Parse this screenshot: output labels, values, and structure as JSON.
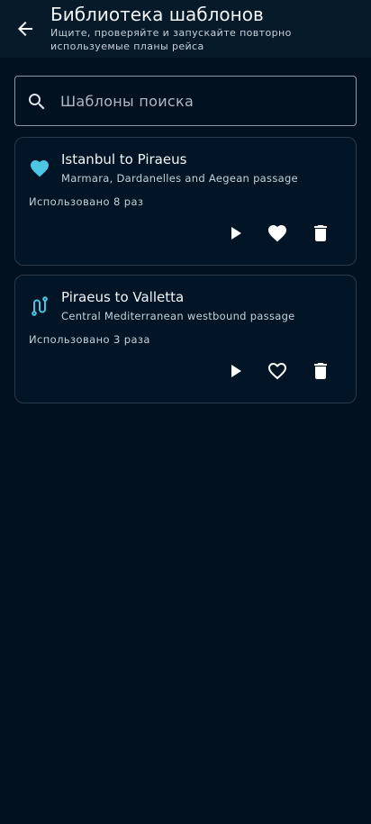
{
  "header": {
    "title": "Библиотека шаблонов",
    "subtitle": "Ищите, проверяйте и запускайте повторно используемые планы рейса"
  },
  "search": {
    "placeholder": "Шаблоны поиска",
    "value": ""
  },
  "templates": [
    {
      "name": "Istanbul to Piraeus",
      "description": "Marmara, Dardanelles and Aegean passage",
      "usage": "Использовано 8 раз",
      "icon": "heart-icon",
      "favorite": true
    },
    {
      "name": "Piraeus to Valletta",
      "description": "Central Mediterranean westbound passage",
      "usage": "Использовано 3 раза",
      "icon": "route-icon",
      "favorite": false
    }
  ],
  "colors": {
    "background": "#01111f",
    "appbar": "#071a2a",
    "accent": "#4cc6e2",
    "card_border": "#2a3947"
  }
}
